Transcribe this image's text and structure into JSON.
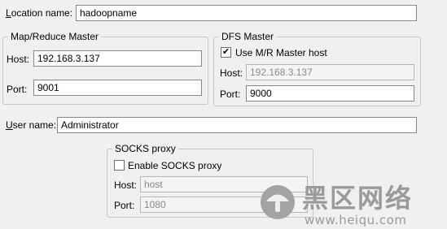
{
  "location": {
    "label_u": "L",
    "label_rest": "ocation name:",
    "value": "hadoopname"
  },
  "mapreduce": {
    "legend": "Map/Reduce Master",
    "host_label": "Host:",
    "host_value": "192.168.3.137",
    "port_label": "Port:",
    "port_value": "9001"
  },
  "dfs": {
    "legend": "DFS Master",
    "use_mr_label": "Use M/R Master host",
    "use_mr_checked": true,
    "host_label": "Host:",
    "host_value": "192.168.3.137",
    "port_label": "Port:",
    "port_value": "9000"
  },
  "user": {
    "label_u": "U",
    "label_rest": "ser name:",
    "value": "Administrator"
  },
  "socks": {
    "legend": "SOCKS proxy",
    "enable_label": "Enable SOCKS proxy",
    "enable_checked": false,
    "host_label": "Host:",
    "host_value": "host",
    "port_label": "Port:",
    "port_value": "1080"
  },
  "watermark": {
    "text_cn": "黑区网络",
    "url": "www.heiqu.com"
  },
  "colors": {
    "field_border": "#828790",
    "group_border": "#c8c8c8",
    "disabled_text": "#8a8a8a",
    "watermark": "#9a9a9a"
  }
}
